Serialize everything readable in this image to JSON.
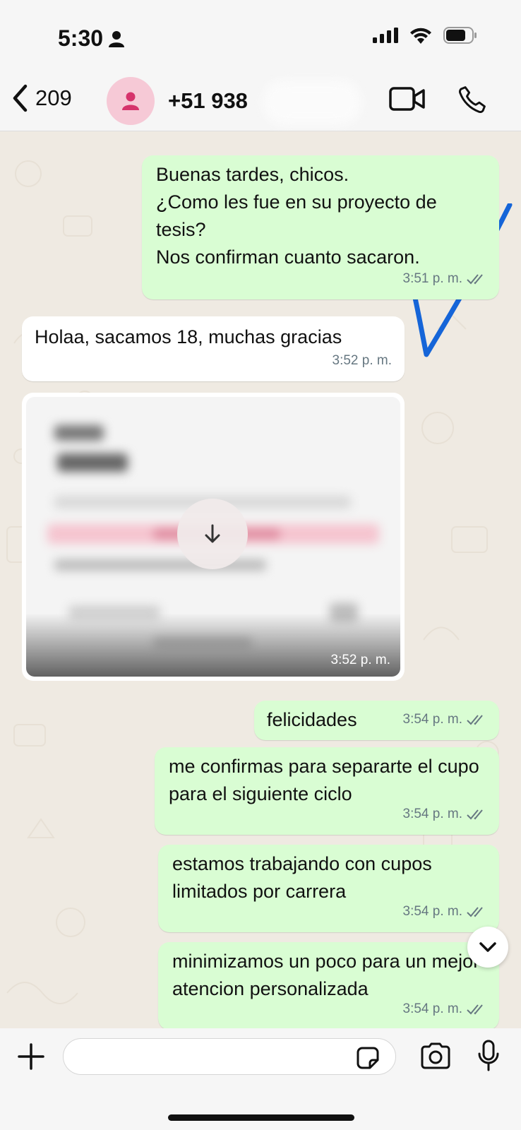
{
  "status_bar": {
    "time": "5:30",
    "icons": [
      "person-icon",
      "signal-icon",
      "wifi-icon",
      "battery-icon"
    ]
  },
  "header": {
    "back_count": "209",
    "contact_name": "+51 938",
    "icons": [
      "back-chevron-icon",
      "avatar-person-icon",
      "video-call-icon",
      "phone-icon"
    ]
  },
  "messages": [
    {
      "direction": "outgoing",
      "text": "Buenas tardes, chicos.\n¿Como les fue en su proyecto de tesis?\nNos confirman cuanto sacaron.",
      "time": "3:51 p. m.",
      "read": true
    },
    {
      "direction": "incoming",
      "text": "Holaa, sacamos 18, muchas gracias",
      "time": "3:52 p. m."
    },
    {
      "direction": "incoming",
      "type": "image",
      "blurred": true,
      "time": "3:52 p. m."
    },
    {
      "direction": "outgoing",
      "text": "felicidades",
      "time": "3:54 p. m.",
      "read": true
    },
    {
      "direction": "outgoing",
      "text": "me confirmas para separarte el cupo para el siguiente ciclo",
      "time": "3:54 p. m.",
      "read": true
    },
    {
      "direction": "outgoing",
      "text": "estamos trabajando con cupos limitados por carrera",
      "time": "3:54 p. m.",
      "read": true
    },
    {
      "direction": "outgoing",
      "text": "minimizamos un poco para un mejor atencion personalizada",
      "time": "3:54 p. m.",
      "read": true
    }
  ],
  "input_bar": {
    "placeholder": "",
    "icons": [
      "plus-icon",
      "sticker-icon",
      "camera-icon",
      "microphone-icon"
    ]
  },
  "colors": {
    "chat_background": "#efeae2",
    "outgoing_bubble": "#d9fdd3",
    "incoming_bubble": "#ffffff",
    "read_ticks": "#667781",
    "hand_drawn_check": "#1565d8",
    "avatar_background": "#f6c9d6",
    "avatar_icon": "#d6336c"
  }
}
